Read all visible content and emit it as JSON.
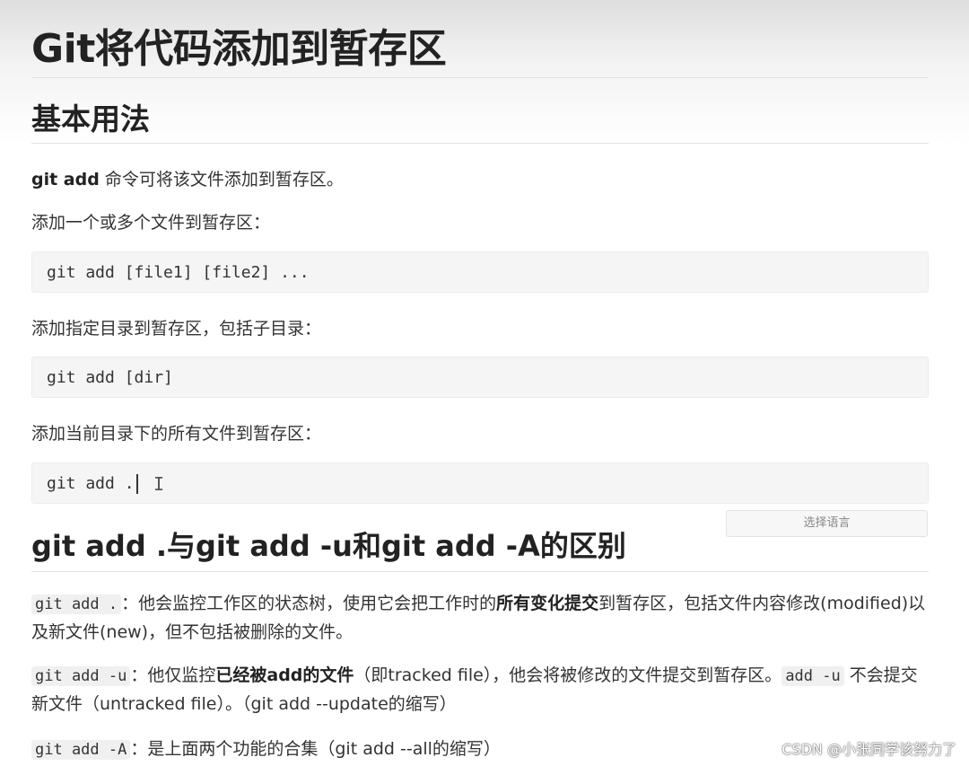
{
  "title": "Git将代码添加到暂存区",
  "section1": {
    "heading": "基本用法",
    "intro_bold": "git add",
    "intro_rest": " 命令可将该文件添加到暂存区。",
    "p1": "添加一个或多个文件到暂存区：",
    "code1": "git add [file1] [file2] ...",
    "p2": "添加指定目录到暂存区，包括子目录：",
    "code2": "git add [dir]",
    "p3": "添加当前目录下的所有文件到暂存区：",
    "code3": "git add ."
  },
  "lang_select_label": "选择语言",
  "section2": {
    "heading": "git add .与git add -u和git add -A的区别",
    "item1": {
      "code": "git add .",
      "text_a": "：他会监控工作区的状态树，使用它会把工作时的",
      "bold": "所有变化提交",
      "text_b": "到暂存区，包括文件内容修改(modified)以及新文件(new)，但不包括被删除的文件。"
    },
    "item2": {
      "code": "git add -u",
      "text_a": "：他仅监控",
      "bold": "已经被add的文件",
      "text_b": "（即tracked file），他会将被修改的文件提交到暂存区。",
      "code2": "add -u",
      "text_c": " 不会提交新文件（untracked file）。（git add --update的缩写）"
    },
    "item3": {
      "code": "git add -A",
      "text_a": "：是上面两个功能的合集（git add --all的缩写）"
    }
  },
  "watermark": "CSDN @小张同学该努力了"
}
